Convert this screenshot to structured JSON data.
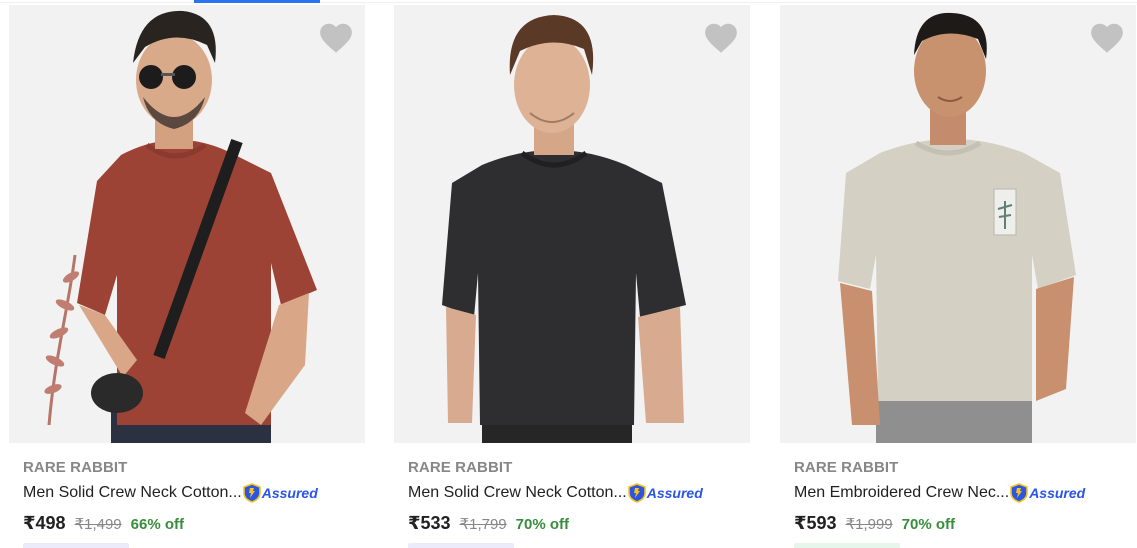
{
  "colors": {
    "accent": "#2874f0",
    "brand_text": "#878787",
    "discount": "#388e3c",
    "assured": "#2a55e5",
    "wishlist": "#c2c2c2"
  },
  "products": [
    {
      "brand": "RARE RABBIT",
      "title": "Men Solid Crew Neck Cotton...",
      "badge": "Assured",
      "price": "₹498",
      "mrp": "₹1,499",
      "discount": "66% off",
      "image": "man in rust crew neck t-shirt with sunglasses and crossbody bag",
      "wishlist_icon": "heart-icon",
      "chip_color": "#ecebfb"
    },
    {
      "brand": "RARE RABBIT",
      "title": "Men Solid Crew Neck Cotton...",
      "badge": "Assured",
      "price": "₹533",
      "mrp": "₹1,799",
      "discount": "70% off",
      "image": "man in black crew neck t-shirt",
      "wishlist_icon": "heart-icon",
      "chip_color": "#ecebfb"
    },
    {
      "brand": "RARE RABBIT",
      "title": "Men Embroidered Crew Nec...",
      "badge": "Assured",
      "price": "₹593",
      "mrp": "₹1,999",
      "discount": "70% off",
      "image": "man in beige crew neck t-shirt with embroidered chest patch",
      "wishlist_icon": "heart-icon",
      "chip_color": "#e6f6ea"
    }
  ]
}
